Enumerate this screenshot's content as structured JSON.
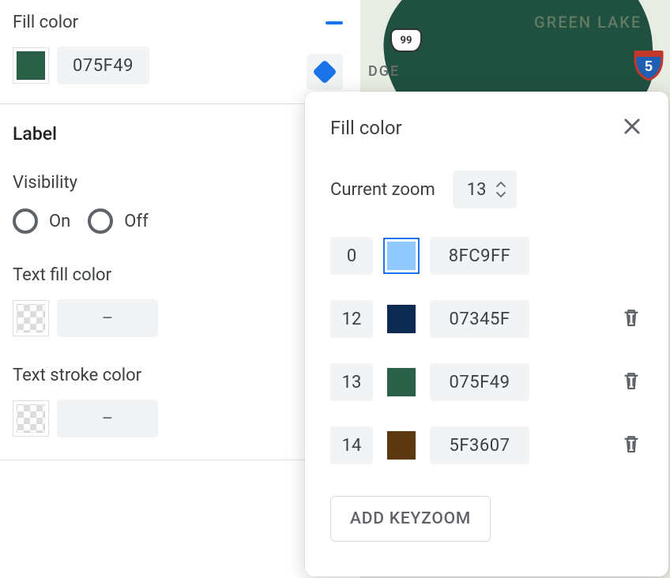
{
  "sidebar": {
    "fill_color_label": "Fill color",
    "fill_color_hex": "075F49",
    "fill_color_swatch": "#2a6047",
    "label_section": "Label",
    "visibility_label": "Visibility",
    "visibility_on": "On",
    "visibility_off": "Off",
    "text_fill_label": "Text fill color",
    "text_fill_value": "–",
    "text_stroke_label": "Text stroke color",
    "text_stroke_value": "–"
  },
  "map": {
    "greenlake": "GREEN LAKE",
    "dge": "DGE",
    "hwy99": "99",
    "i5": "5"
  },
  "popover": {
    "title": "Fill color",
    "zoom_label": "Current zoom",
    "zoom_value": "13",
    "keyzooms": [
      {
        "zoom": "0",
        "hex": "8FC9FF",
        "color": "#8FC9FF",
        "selected": true,
        "deletable": false
      },
      {
        "zoom": "12",
        "hex": "07345F",
        "color": "#0d2a52",
        "selected": false,
        "deletable": true
      },
      {
        "zoom": "13",
        "hex": "075F49",
        "color": "#2a6047",
        "selected": false,
        "deletable": true
      },
      {
        "zoom": "14",
        "hex": "5F3607",
        "color": "#5b3810",
        "selected": false,
        "deletable": true
      }
    ],
    "add_button": "ADD KEYZOOM"
  }
}
